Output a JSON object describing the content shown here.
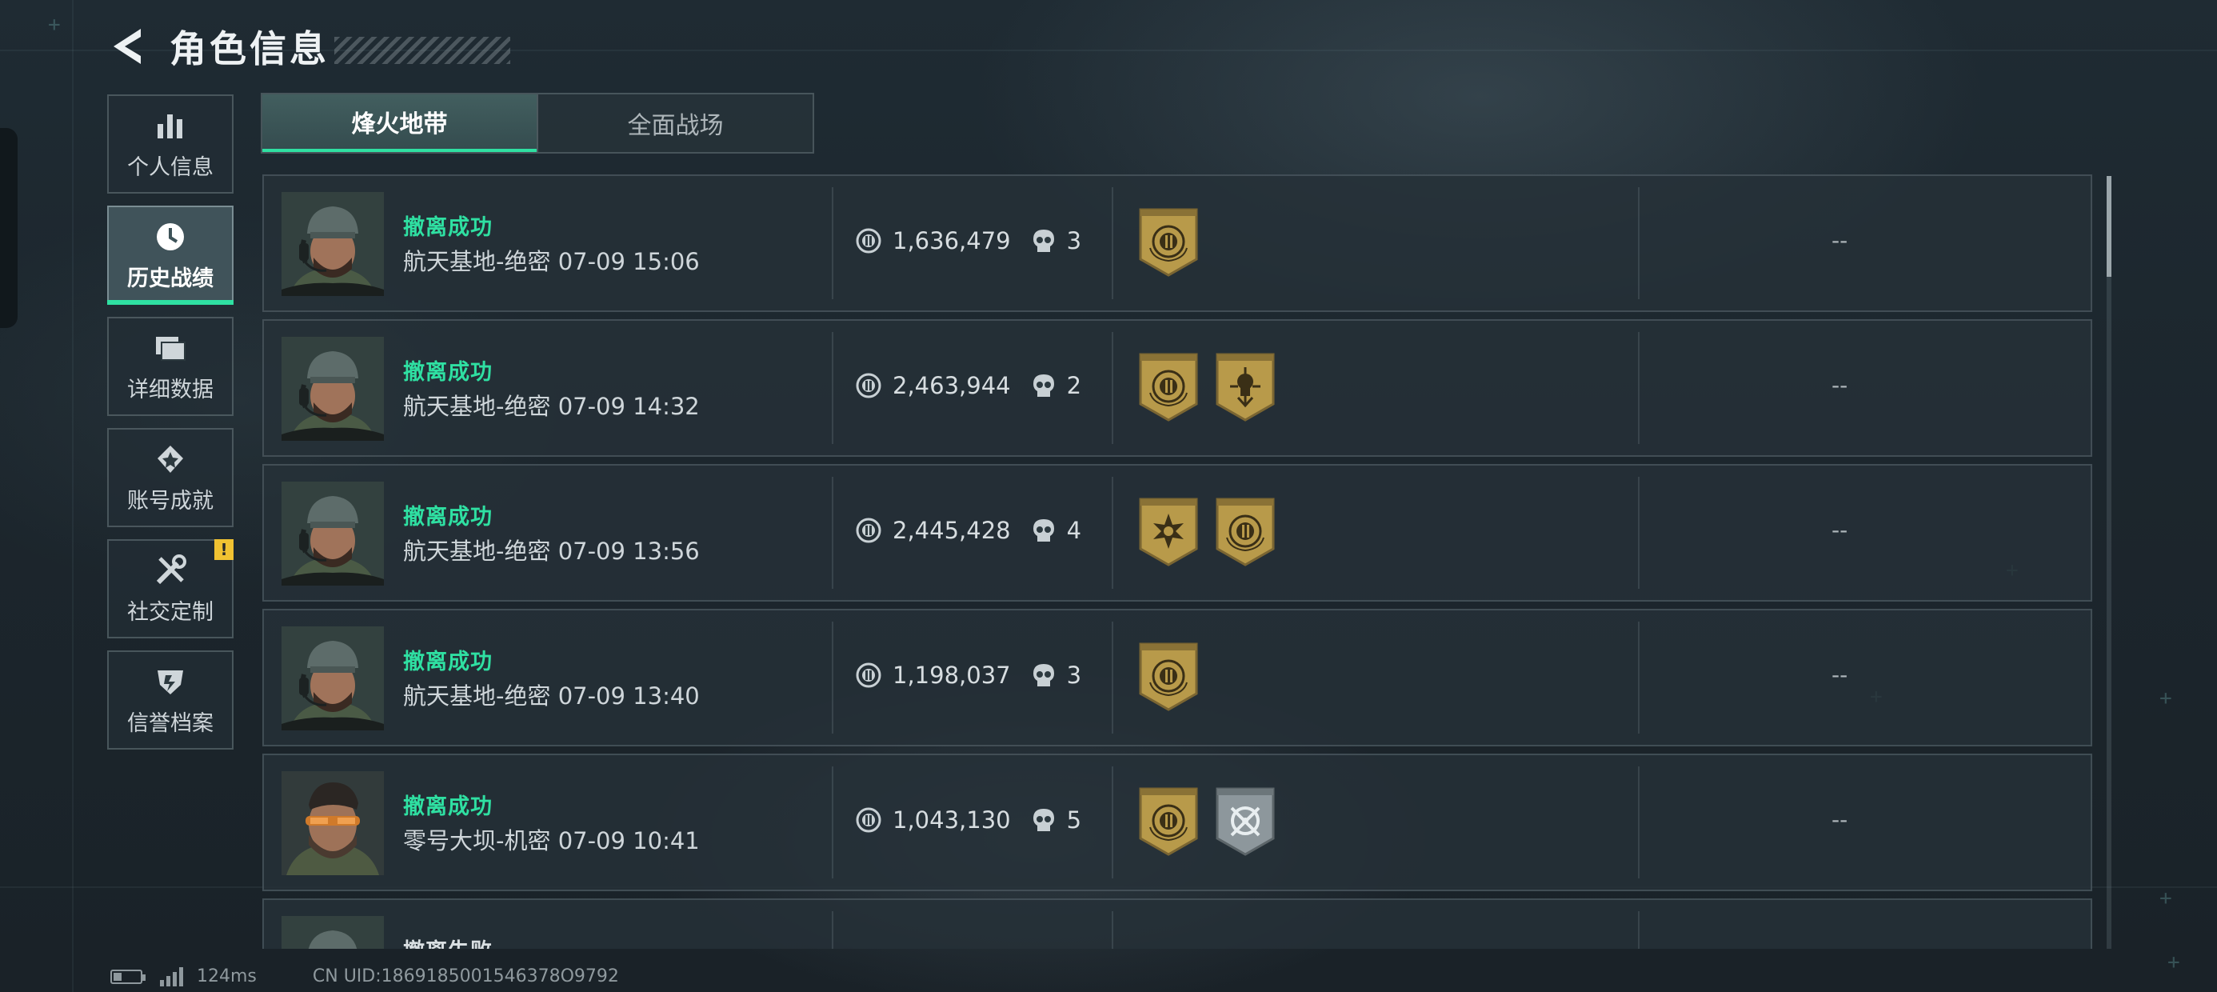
{
  "header": {
    "title": "角色信息",
    "back_icon": "back-arrow-icon"
  },
  "sidebar": {
    "items": [
      {
        "label": "个人信息",
        "icon": "bar-chart-icon",
        "active": false,
        "badge": ""
      },
      {
        "label": "历史战绩",
        "icon": "clock-icon",
        "active": true,
        "badge": ""
      },
      {
        "label": "详细数据",
        "icon": "folders-icon",
        "active": false,
        "badge": ""
      },
      {
        "label": "账号成就",
        "icon": "achievement-icon",
        "active": false,
        "badge": ""
      },
      {
        "label": "社交定制",
        "icon": "tools-icon",
        "active": false,
        "badge": "!"
      },
      {
        "label": "信誉档案",
        "icon": "shield-icon",
        "active": false,
        "badge": ""
      }
    ]
  },
  "tabs": [
    {
      "label": "烽火地带",
      "active": true
    },
    {
      "label": "全面战场",
      "active": false
    }
  ],
  "records": [
    {
      "result": "撤离成功",
      "map": "航天基地-绝密",
      "time": "07-09 15:06",
      "value": "1,636,479",
      "kills": "3",
      "medals": [
        "gold-emblem-medal-icon"
      ],
      "extra": "--",
      "avatar": "operator-cap-avatar"
    },
    {
      "result": "撤离成功",
      "map": "航天基地-绝密",
      "time": "07-09 14:32",
      "value": "2,463,944",
      "kills": "2",
      "medals": [
        "gold-emblem-medal-icon",
        "gold-skull-medal-icon"
      ],
      "extra": "--",
      "avatar": "operator-cap-avatar"
    },
    {
      "result": "撤离成功",
      "map": "航天基地-绝密",
      "time": "07-09 13:56",
      "value": "2,445,428",
      "kills": "4",
      "medals": [
        "gold-star-medal-icon",
        "gold-emblem-medal-icon"
      ],
      "extra": "--",
      "avatar": "operator-cap-avatar"
    },
    {
      "result": "撤离成功",
      "map": "航天基地-绝密",
      "time": "07-09 13:40",
      "value": "1,198,037",
      "kills": "3",
      "medals": [
        "gold-emblem-medal-icon"
      ],
      "extra": "--",
      "avatar": "operator-cap-avatar"
    },
    {
      "result": "撤离成功",
      "map": "零号大坝-机密",
      "time": "07-09 10:41",
      "value": "1,043,130",
      "kills": "5",
      "medals": [
        "gold-emblem-medal-icon",
        "silver-crosshair-medal-icon"
      ],
      "extra": "--",
      "avatar": "operator-goggles-avatar"
    },
    {
      "result": "撤离失败",
      "map": "",
      "time": "",
      "value": "",
      "kills": "",
      "medals": [],
      "extra": "",
      "avatar": "operator-cap-avatar"
    }
  ],
  "footer": {
    "ping": "124ms",
    "uid": "CN UID:1869185001546378O9792"
  },
  "colors": {
    "accent": "#2fe0a2",
    "warning": "#f1c232",
    "gold": "#b89a4a",
    "silver": "#8d979c"
  }
}
